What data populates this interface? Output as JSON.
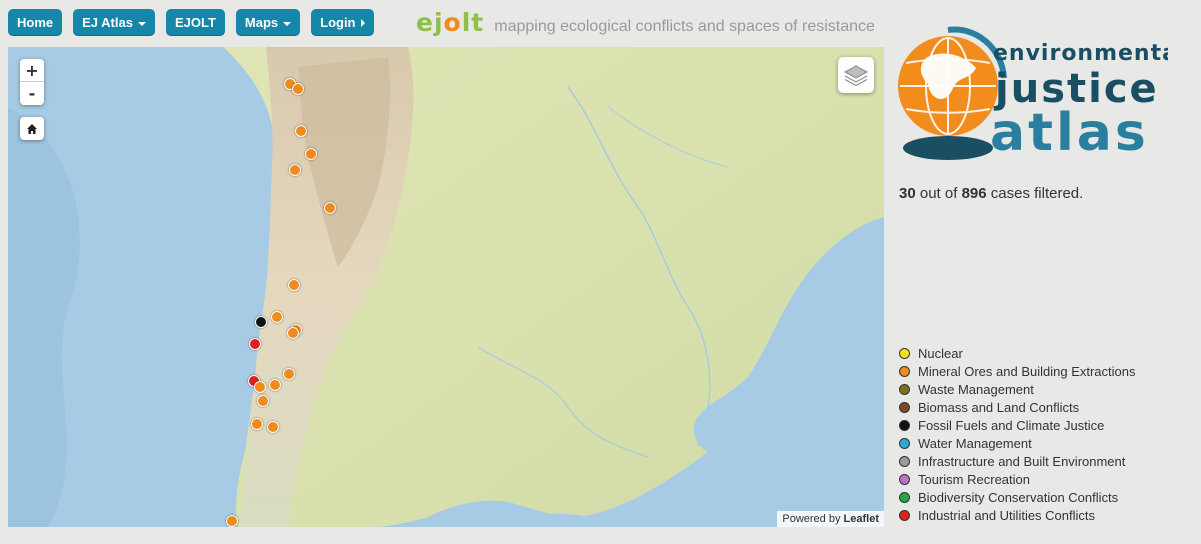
{
  "nav": {
    "items": [
      {
        "label": "Home",
        "arrow": ""
      },
      {
        "label": "EJ Atlas",
        "arrow": "down"
      },
      {
        "label": "EJOLT",
        "arrow": ""
      },
      {
        "label": "Maps",
        "arrow": "down"
      },
      {
        "label": "Login",
        "arrow": "right"
      }
    ]
  },
  "header": {
    "brand_prefix": "ej",
    "brand_o": "o",
    "brand_suffix": "lt",
    "tagline": "mapping ecological conflicts and spaces of resistance"
  },
  "logo": {
    "line1": "environmental",
    "line2": "justice",
    "line3": "atlas"
  },
  "counter": {
    "filtered": "30",
    "mid": "out of",
    "total": "896",
    "suffix": "cases filtered."
  },
  "map": {
    "zoom_in": "+",
    "zoom_out": "-",
    "attribution_prefix": "Powered by",
    "attribution_link": "Leaflet",
    "icons": [
      "home-icon",
      "layers-icon"
    ],
    "markers": [
      {
        "category": "Mineral Ores and Building Extractions"
      },
      {
        "category": "Mineral Ores and Building Extractions"
      },
      {
        "category": "Mineral Ores and Building Extractions"
      },
      {
        "category": "Mineral Ores and Building Extractions"
      },
      {
        "category": "Mineral Ores and Building Extractions"
      },
      {
        "category": "Mineral Ores and Building Extractions"
      },
      {
        "category": "Mineral Ores and Building Extractions"
      },
      {
        "category": "Mineral Ores and Building Extractions"
      },
      {
        "category": "Fossil Fuels and Climate Justice"
      },
      {
        "category": "Mineral Ores and Building Extractions"
      },
      {
        "category": "Mineral Ores and Building Extractions"
      },
      {
        "category": "Industrial and Utilities Conflicts"
      },
      {
        "category": "Industrial and Utilities Conflicts"
      },
      {
        "category": "Mineral Ores and Building Extractions"
      },
      {
        "category": "Mineral Ores and Building Extractions"
      },
      {
        "category": "Mineral Ores and Building Extractions"
      },
      {
        "category": "Mineral Ores and Building Extractions"
      },
      {
        "category": "Mineral Ores and Building Extractions"
      },
      {
        "category": "Mineral Ores and Building Extractions"
      },
      {
        "category": "Mineral Ores and Building Extractions"
      }
    ]
  },
  "legend": {
    "items": [
      {
        "label": "Nuclear",
        "color": "#f5e020"
      },
      {
        "label": "Mineral Ores and Building Extractions",
        "color": "#f08a1c"
      },
      {
        "label": "Waste Management",
        "color": "#7b6f24"
      },
      {
        "label": "Biomass and Land Conflicts",
        "color": "#7a4a2a"
      },
      {
        "label": "Fossil Fuels and Climate Justice",
        "color": "#111111"
      },
      {
        "label": "Water Management",
        "color": "#2ea8d8"
      },
      {
        "label": "Infrastructure and Built Environment",
        "color": "#9a9a9a"
      },
      {
        "label": "Tourism Recreation",
        "color": "#c070c8"
      },
      {
        "label": "Biodiversity Conservation Conflicts",
        "color": "#22a844"
      },
      {
        "label": "Industrial and Utilities Conflicts",
        "color": "#e02020"
      }
    ]
  }
}
